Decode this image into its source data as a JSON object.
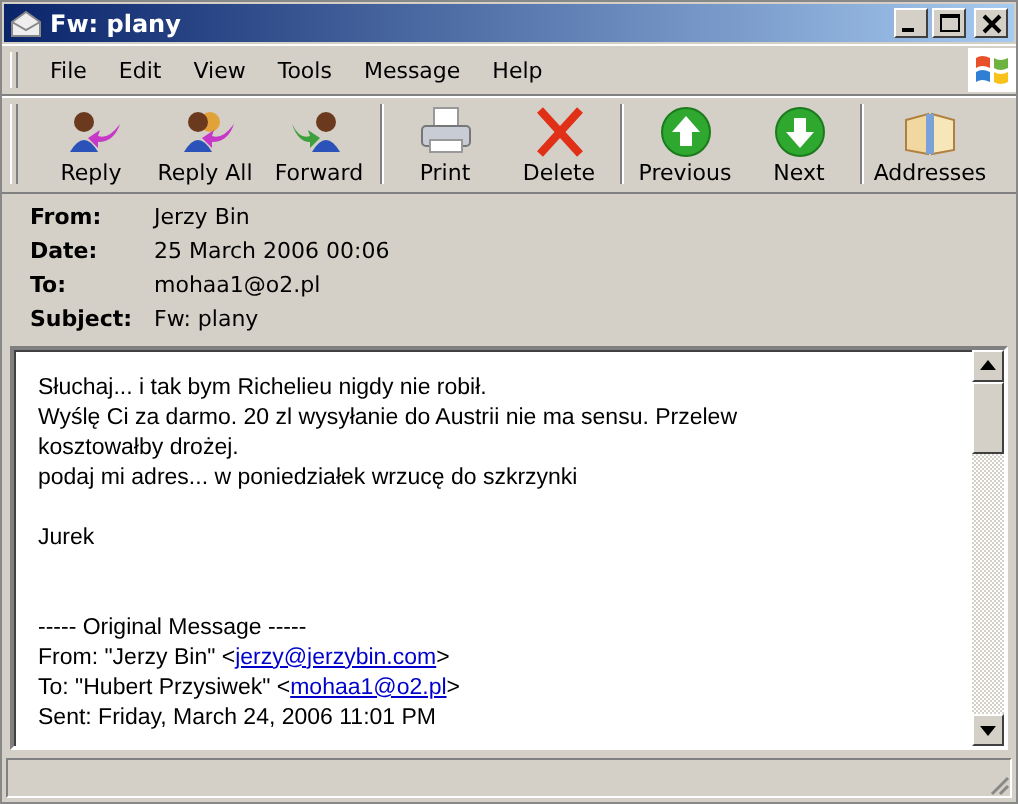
{
  "window": {
    "title": "Fw: plany"
  },
  "menu": [
    "File",
    "Edit",
    "View",
    "Tools",
    "Message",
    "Help"
  ],
  "toolbar": [
    [
      {
        "label": "Reply",
        "kind": "reply"
      },
      {
        "label": "Reply All",
        "kind": "reply_all"
      },
      {
        "label": "Forward",
        "kind": "forward"
      }
    ],
    [
      {
        "label": "Print",
        "kind": "print"
      },
      {
        "label": "Delete",
        "kind": "delete"
      }
    ],
    [
      {
        "label": "Previous",
        "kind": "previous"
      },
      {
        "label": "Next",
        "kind": "next"
      }
    ],
    [
      {
        "label": "Addresses",
        "kind": "addresses"
      }
    ]
  ],
  "header": [
    {
      "label": "From:",
      "value": "Jerzy Bin"
    },
    {
      "label": "Date:",
      "value": "25 March 2006 00:06"
    },
    {
      "label": "To:",
      "value": "mohaa1@o2.pl"
    },
    {
      "label": "Subject:",
      "value": "Fw: plany"
    }
  ],
  "body": [
    {
      "text": "Słuchaj... i tak bym Richelieu nigdy nie robił."
    },
    {
      "text": "Wyślę Ci za darmo. 20 zl wysyłanie do Austrii nie ma sensu. Przelew"
    },
    {
      "text": "kosztowałby drożej."
    },
    {
      "text": "podaj mi adres... w poniedziałek wrzucę do szkrzynki"
    },
    {
      "kind": "blank"
    },
    {
      "text": "Jurek"
    },
    {
      "kind": "blank"
    },
    {
      "kind": "blank"
    },
    {
      "text": "----- Original Message -----"
    },
    {
      "text": "From: \"Jerzy Bin\" <",
      "link": "jerzy@jerzybin.com",
      "after": ">"
    },
    {
      "text": "To: \"Hubert Przysiwek\" <",
      "link": "mohaa1@o2.pl",
      "after": ">"
    },
    {
      "text": "Sent: Friday, March 24, 2006 11:01 PM"
    }
  ]
}
